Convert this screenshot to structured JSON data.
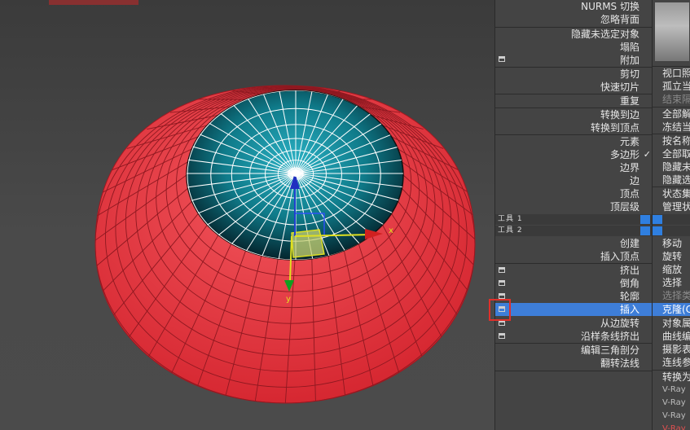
{
  "menu": {
    "items": [
      {
        "label": "NURMS 切换"
      },
      {
        "label": "忽略背面"
      },
      {
        "label": "隐藏未选定对象"
      },
      {
        "label": "塌陷"
      },
      {
        "label": "附加"
      },
      {
        "label": "剪切"
      },
      {
        "label": "快速切片"
      },
      {
        "label": "重复"
      },
      {
        "label": "转换到边"
      },
      {
        "label": "转换到顶点"
      },
      {
        "label": "元素"
      },
      {
        "label": "多边形",
        "checked": true
      },
      {
        "label": "边界"
      },
      {
        "label": "边"
      },
      {
        "label": "顶点"
      },
      {
        "label": "顶层级"
      },
      {
        "label": "创建"
      },
      {
        "label": "插入顶点"
      },
      {
        "label": "挤出"
      },
      {
        "label": "倒角"
      },
      {
        "label": "轮廓"
      },
      {
        "label": "插入",
        "active": true
      },
      {
        "label": "从边旋转"
      },
      {
        "label": "沿样条线挤出"
      },
      {
        "label": "编辑三角剖分"
      },
      {
        "label": "翻转法线"
      }
    ],
    "check_mark": "✓",
    "tools1": "工具 1",
    "tools2": "工具 2"
  },
  "menu2": {
    "items": [
      {
        "label": "视口照"
      },
      {
        "label": "孤立当"
      },
      {
        "label": "结束隔",
        "dim": true
      },
      {
        "label": "全部解"
      },
      {
        "label": "冻结当"
      },
      {
        "label": "按名称"
      },
      {
        "label": "全部取"
      },
      {
        "label": "隐藏未"
      },
      {
        "label": "隐藏选"
      },
      {
        "label": "状态集"
      },
      {
        "label": "管理状"
      },
      {
        "label": "移动"
      },
      {
        "label": "旋转"
      },
      {
        "label": "缩放"
      },
      {
        "label": "选择"
      },
      {
        "label": "选择类",
        "dim": true
      },
      {
        "label": "克隆(C",
        "active": true
      },
      {
        "label": "对象属"
      },
      {
        "label": "曲线编"
      },
      {
        "label": "摄影表"
      },
      {
        "label": "连线参"
      },
      {
        "label": "转换为"
      },
      {
        "label": "V-Ray",
        "small": true
      },
      {
        "label": "V-Ray",
        "small": true
      },
      {
        "label": "V-Ray",
        "small": true
      },
      {
        "label": "V-Ray",
        "small": true
      }
    ]
  },
  "viewport": {
    "axis_x": "x",
    "axis_y": "y",
    "colors": {
      "shell": "#e8303a",
      "inner": "#0f7b8a",
      "wire": "#ffffff",
      "axis_x": "#d02020",
      "axis_y": "#10a020",
      "axis_z": "#1030c0",
      "gizmo": "#e0e020"
    }
  }
}
